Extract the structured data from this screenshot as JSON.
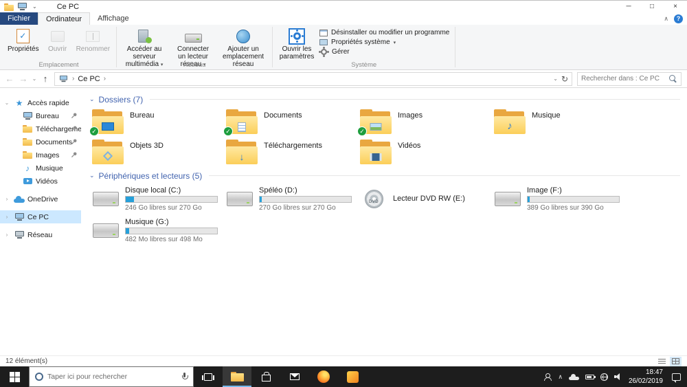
{
  "icons": {
    "check": "✓",
    "star": "★",
    "music_note": "♪",
    "down_arrow": "↓",
    "back_arrow": "←",
    "forward_arrow": "→",
    "up_arrow": "↑",
    "refresh": "↻",
    "chevron_down": "⌄",
    "chevron_up": "∧",
    "chevron_right": "›",
    "dropdown": "▾",
    "help": "?",
    "minimize": "─",
    "maximize": "□",
    "close": "×"
  },
  "colors": {
    "accent_blue": "#2b7cd3",
    "file_tab_blue": "#26497f",
    "group_header_blue": "#4062ae",
    "capacity_bar_blue": "#26a0da",
    "selection_blue": "#cce8ff",
    "taskbar_bg": "#1d1d1d",
    "sync_badge_green": "#1e9e3e"
  },
  "titlebar": {
    "title": "Ce PC"
  },
  "ribbon": {
    "tabs": [
      {
        "label": "Fichier"
      },
      {
        "label": "Ordinateur"
      },
      {
        "label": "Affichage"
      }
    ],
    "groups": {
      "emplacement": {
        "label": "Emplacement",
        "proprietes": "Propriétés",
        "ouvrir": "Ouvrir",
        "renommer": "Renommer"
      },
      "reseau": {
        "label": "Réseau",
        "media_server": "Accéder au serveur multimédia",
        "map_drive": "Connecter un lecteur réseau",
        "add_location": "Ajouter un emplacement réseau"
      },
      "systeme": {
        "label": "Système",
        "open_settings": "Ouvrir les paramètres",
        "uninstall": "Désinstaller ou modifier un programme",
        "system_props": "Propriétés système",
        "manage": "Gérer"
      }
    }
  },
  "address_bar": {
    "breadcrumb_root": "Ce PC",
    "search_placeholder": "Rechercher dans : Ce PC"
  },
  "sidebar": {
    "items": [
      {
        "label": "Accès rapide",
        "pinned": false,
        "selected": false
      },
      {
        "label": "Bureau",
        "pinned": true,
        "selected": false
      },
      {
        "label": "Téléchargements",
        "pinned": true,
        "selected": false
      },
      {
        "label": "Documents",
        "pinned": true,
        "selected": false
      },
      {
        "label": "Images",
        "pinned": true,
        "selected": false
      },
      {
        "label": "Musique",
        "pinned": false,
        "selected": false
      },
      {
        "label": "Vidéos",
        "pinned": false,
        "selected": false
      },
      {
        "label": "OneDrive",
        "pinned": false,
        "selected": false
      },
      {
        "label": "Ce PC",
        "pinned": false,
        "selected": true
      },
      {
        "label": "Réseau",
        "pinned": false,
        "selected": false
      }
    ]
  },
  "main": {
    "folders_section": {
      "title": "Dossiers (7)",
      "items": [
        {
          "name": "Bureau",
          "synced": true
        },
        {
          "name": "Documents",
          "synced": true
        },
        {
          "name": "Images",
          "synced": true
        },
        {
          "name": "Musique",
          "synced": false
        },
        {
          "name": "Objets 3D",
          "synced": false
        },
        {
          "name": "Téléchargements",
          "synced": false
        },
        {
          "name": "Vidéos",
          "synced": false
        }
      ]
    },
    "drives_section": {
      "title": "Périphériques et lecteurs (5)",
      "items": [
        {
          "name": "Disque local (C:)",
          "info": "246 Go libres sur 270 Go",
          "used_pct": 9,
          "kind": "hdd"
        },
        {
          "name": "Spéléo (D:)",
          "info": "270 Go libres sur 270 Go",
          "used_pct": 2,
          "kind": "hdd"
        },
        {
          "name": "Lecteur DVD RW (E:)",
          "info": "",
          "kind": "dvd"
        },
        {
          "name": "Image (F:)",
          "info": "389 Go libres sur 390 Go",
          "used_pct": 2,
          "kind": "hdd"
        },
        {
          "name": "Musique (G:)",
          "info": "482 Mo libres sur 498 Mo",
          "used_pct": 4,
          "kind": "hdd"
        }
      ]
    }
  },
  "status_bar": {
    "count": "12 élément(s)"
  },
  "taskbar": {
    "search_placeholder": "Taper ici pour rechercher",
    "clock": {
      "time": "18:47",
      "date": "26/02/2019"
    }
  }
}
